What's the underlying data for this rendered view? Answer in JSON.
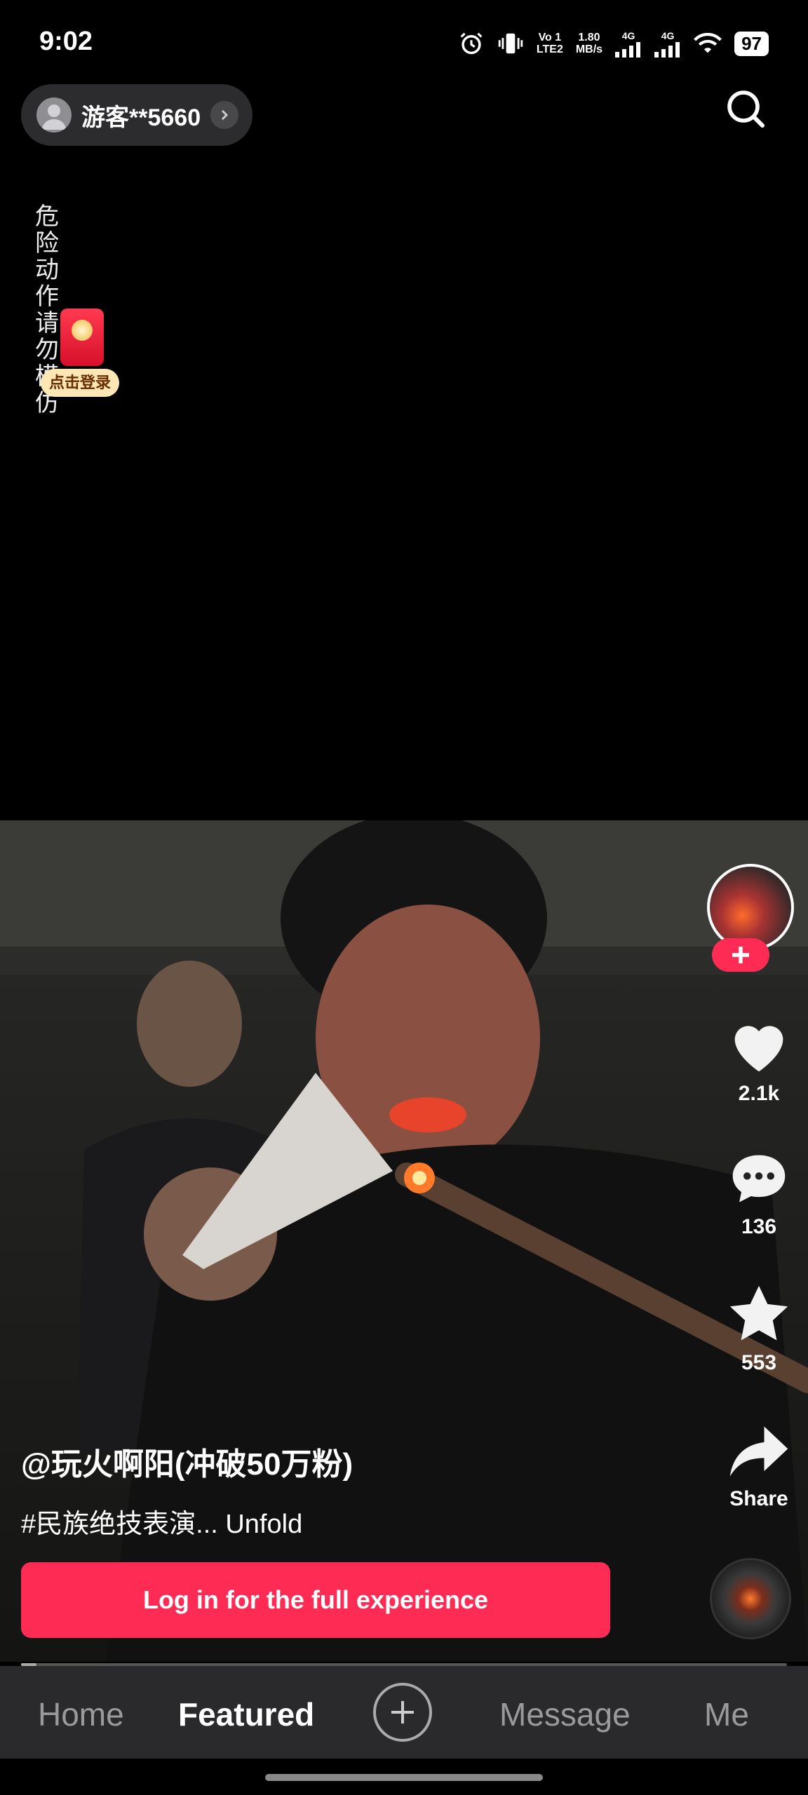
{
  "status_bar": {
    "time": "9:02",
    "volte": "Vo 1",
    "lte": "LTE2",
    "speed_value": "1.80",
    "speed_unit": "MB/s",
    "net1": "4G",
    "net2": "4G",
    "battery": "97"
  },
  "header": {
    "username": "游客**5660"
  },
  "overlay": {
    "warning_text": "危险动作请勿模仿",
    "red_packet_label": "点击登录"
  },
  "actions": {
    "likes": "2.1k",
    "comments": "136",
    "favorites": "553",
    "share_label": "Share"
  },
  "video": {
    "author": "@玩火啊阳(冲破50万粉)",
    "caption": "#民族绝技表演... Unfold",
    "progress_fraction": 0.02
  },
  "login": {
    "button_label": "Log in for the full experience"
  },
  "nav": {
    "home": "Home",
    "featured": "Featured",
    "message": "Message",
    "me": "Me"
  },
  "colors": {
    "accent": "#fe2c55",
    "nav_bg": "#2a2a2c"
  }
}
